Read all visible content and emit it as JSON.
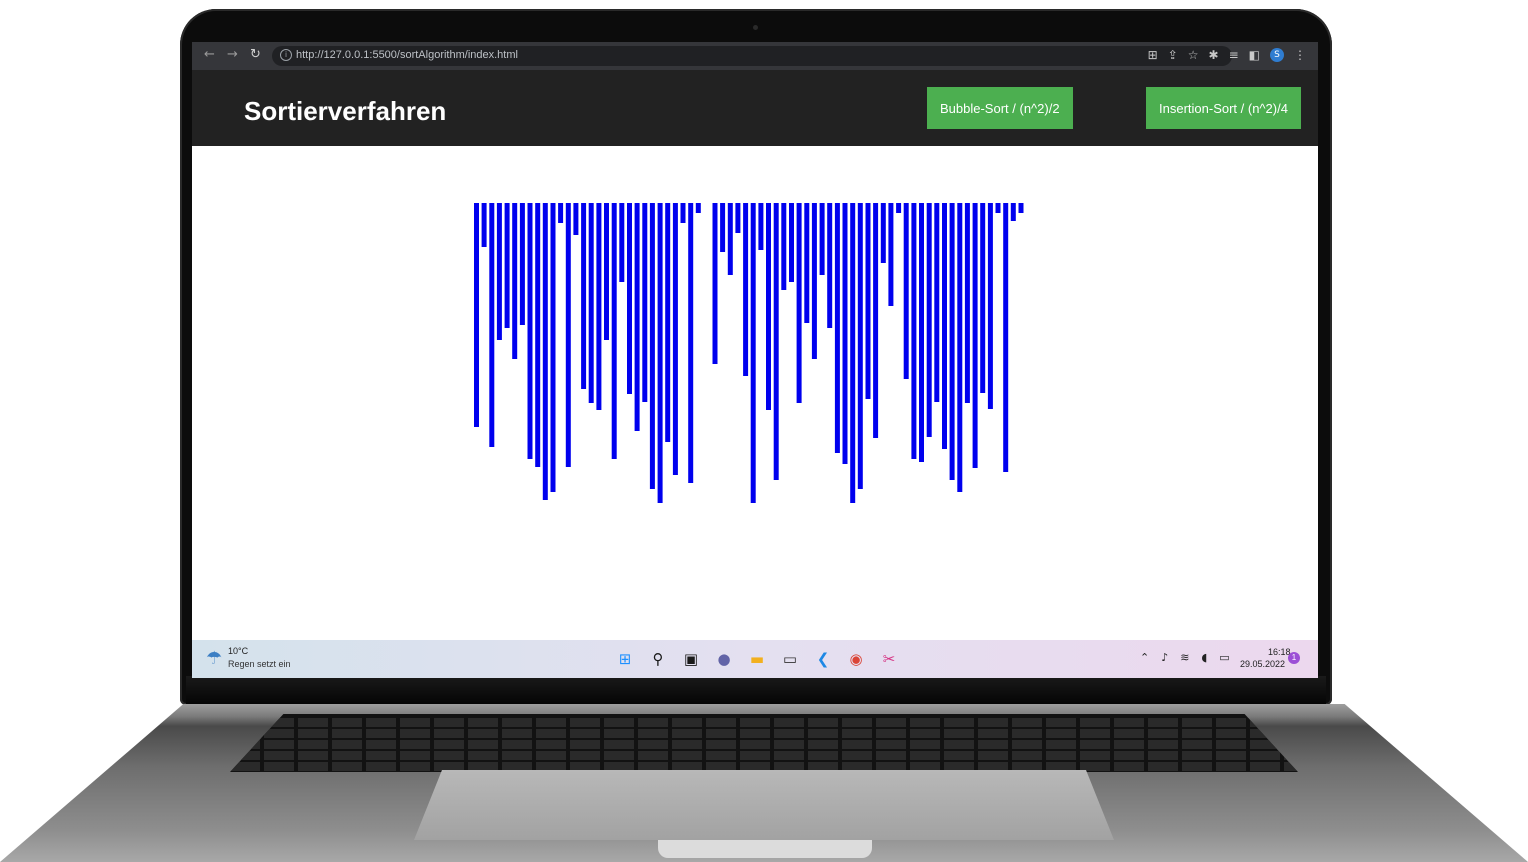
{
  "browser": {
    "url": "http://127.0.0.1:5500/sortAlgorithm/index.html",
    "back_icon": "←",
    "forward_icon": "→",
    "reload_icon": "↻",
    "info_icon": "i"
  },
  "app": {
    "title": "Sortierverfahren",
    "buttons": [
      {
        "label": "Bubble-Sort / (n^2)/2"
      },
      {
        "label": "Insertion-Sort / (n^2)/4"
      }
    ],
    "button_color": "#4caf50",
    "bar_color": "#0000ee"
  },
  "bars": {
    "values": [
      214,
      34,
      234,
      127,
      115,
      146,
      112,
      246,
      254,
      287,
      279,
      10,
      254,
      22,
      176,
      190,
      197,
      127,
      246,
      69,
      181,
      218,
      189,
      276,
      290,
      229,
      262,
      10,
      270,
      0,
      151,
      39,
      62,
      20,
      163,
      290,
      37,
      197,
      267,
      77,
      69,
      190,
      110,
      146,
      62,
      115,
      240,
      251,
      290,
      276,
      186,
      225,
      50,
      93,
      0,
      166,
      246,
      249,
      224,
      189,
      236,
      267,
      279,
      190,
      255,
      180,
      196,
      0,
      259,
      8,
      0
    ],
    "gaps_after": [
      29
    ]
  },
  "taskbar": {
    "weather_temp": "10°C",
    "weather_text": "Regen setzt ein",
    "time": "16:18",
    "date": "29.05.2022",
    "notifications": "1"
  }
}
